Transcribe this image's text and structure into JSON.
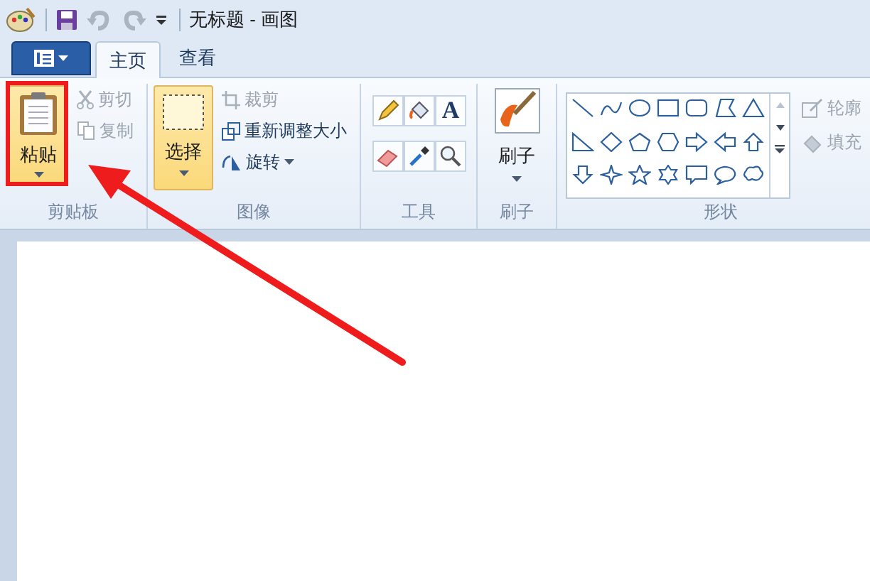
{
  "window": {
    "title": "无标题 - 画图"
  },
  "tabs": [
    {
      "label": "主页",
      "selected": true
    },
    {
      "label": "查看",
      "selected": false
    }
  ],
  "ribbon": {
    "clipboard": {
      "label": "剪贴板",
      "paste": "粘贴",
      "cut": {
        "label": "剪切",
        "disabled": true
      },
      "copy": {
        "label": "复制",
        "disabled": true
      }
    },
    "image": {
      "label": "图像",
      "select": "选择",
      "crop": {
        "label": "裁剪",
        "disabled": true
      },
      "resize": {
        "label": "重新调整大小",
        "disabled": false
      },
      "rotate": {
        "label": "旋转",
        "disabled": false
      }
    },
    "tools": {
      "label": "工具",
      "text_tool": "A"
    },
    "brushes": {
      "label": "刷子",
      "button": "刷子"
    },
    "shapes": {
      "label": "形状",
      "outline": {
        "label": "轮廓",
        "disabled": true
      },
      "fill": {
        "label": "填充",
        "disabled": true
      }
    }
  }
}
